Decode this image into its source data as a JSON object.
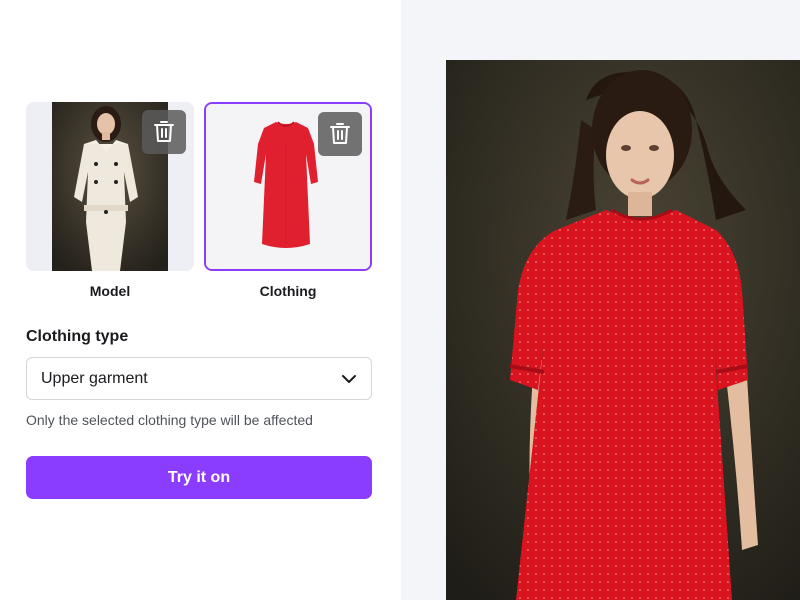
{
  "model": {
    "label": "Model",
    "delete_icon": "trash-icon"
  },
  "clothing": {
    "label": "Clothing",
    "delete_icon": "trash-icon"
  },
  "clothing_type": {
    "title": "Clothing type",
    "selected": "Upper garment",
    "hint": "Only the selected clothing type will be affected"
  },
  "actions": {
    "try_on_label": "Try it on"
  },
  "colors": {
    "accent": "#8b3dff",
    "garment": "#e0202e",
    "right_panel_bg": "#f4f5f8"
  }
}
